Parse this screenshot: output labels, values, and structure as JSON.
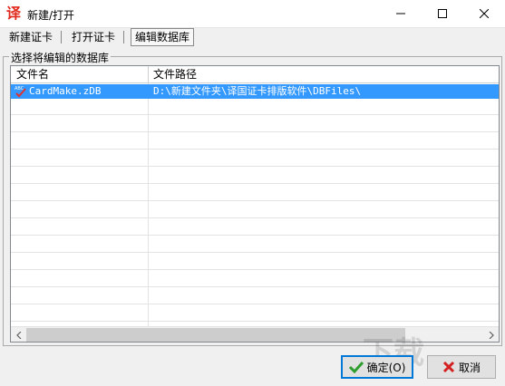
{
  "window": {
    "app_icon_glyph": "译",
    "title": "新建/打开",
    "controls": [
      "minimize-icon",
      "maximize-icon",
      "close-icon"
    ]
  },
  "tabs": [
    {
      "label": "新建证卡",
      "active": false
    },
    {
      "label": "打开证卡",
      "active": false
    },
    {
      "label": "编辑数据库",
      "active": true
    }
  ],
  "group": {
    "label": "选择将编辑的数据库"
  },
  "table": {
    "columns": [
      "文件名",
      "文件路径"
    ],
    "rows": [
      {
        "icon": "database-check-icon",
        "name": "CardMake.zDB",
        "path": "D:\\新建文件夹\\译国证卡排版软件\\DBFiles\\",
        "selected": true
      }
    ]
  },
  "buttons": {
    "ok_label": "确定(O)",
    "cancel_label": "取消"
  },
  "colors": {
    "selection": "#3399ff",
    "ok_icon": "#2e9e2e",
    "cancel_icon": "#d42020",
    "app_icon": "#e0281b"
  }
}
